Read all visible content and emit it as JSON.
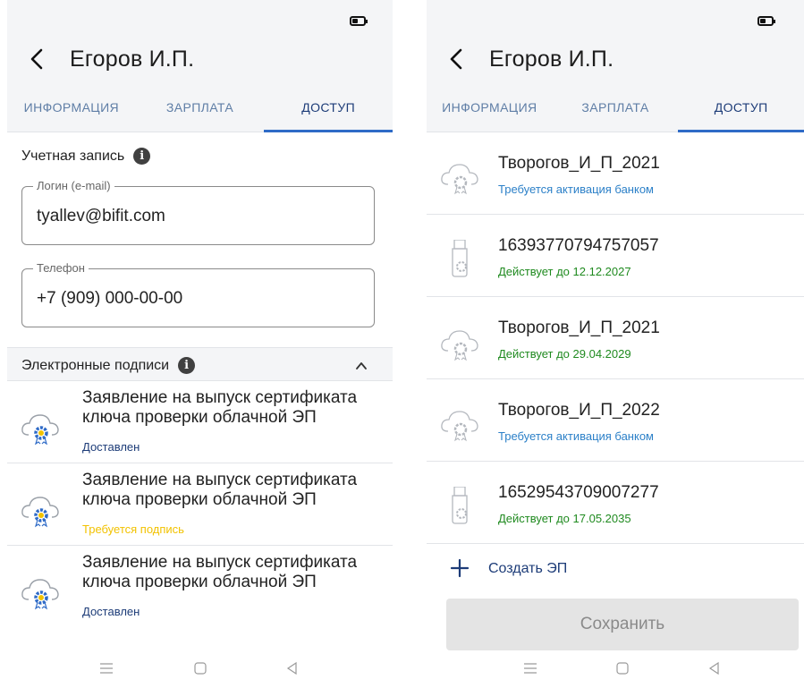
{
  "colors": {
    "accent": "#2f6bc7",
    "tab_inactive": "#5f7ea6",
    "tab_active": "#1d3c78",
    "status_blue": "#2c80c8",
    "status_green": "#1f8a1f",
    "status_yellow": "#f2c200",
    "status_navy": "#1d3c78",
    "header_bg": "#f4f5f7"
  },
  "left": {
    "header": {
      "title": "Егоров И.П.",
      "back_icon": "back-arrow-icon"
    },
    "tabs": [
      "ИНФОРМАЦИЯ",
      "ЗАРПЛАТА",
      "ДОСТУП"
    ],
    "active_tab": "ДОСТУП",
    "account": {
      "title": "Учетная запись",
      "login_label": "Логин (e-mail)",
      "login_value": "tyallev@bifit.com",
      "phone_label": "Телефон",
      "phone_value": "+7 (909) 000-00-00"
    },
    "signatures": {
      "title": "Электронные подписи",
      "items": [
        {
          "line1": "Заявление на выпуск сертификата",
          "line2": "ключа проверки облачной ЭП",
          "status": "Доставлен",
          "status_color": "navy"
        },
        {
          "line1": "Заявление на выпуск сертификата",
          "line2": "ключа проверки облачной ЭП",
          "status": "Требуется подпись",
          "status_color": "yellow"
        },
        {
          "line1": "Заявление на выпуск сертификата",
          "line2": "ключа проверки облачной ЭП",
          "status": "Доставлен",
          "status_color": "navy"
        }
      ]
    }
  },
  "right": {
    "header": {
      "title": "Егоров И.П.",
      "back_icon": "back-arrow-icon"
    },
    "tabs": [
      "ИНФОРМАЦИЯ",
      "ЗАРПЛАТА",
      "ДОСТУП"
    ],
    "active_tab": "ДОСТУП",
    "certificates": [
      {
        "name": "Творогов_И_П_2021",
        "status": "Требуется активация банком",
        "status_color": "blue",
        "icon": "cloud-cert-icon"
      },
      {
        "name": "16393770794757057",
        "status": "Действует до 12.12.2027",
        "status_color": "green",
        "icon": "usb-token-icon"
      },
      {
        "name": "Творогов_И_П_2021",
        "status": "Действует до 29.04.2029",
        "status_color": "green",
        "icon": "cloud-cert-icon"
      },
      {
        "name": "Творогов_И_П_2022",
        "status": "Требуется активация банком",
        "status_color": "blue",
        "icon": "cloud-cert-icon"
      },
      {
        "name": "16529543709007277",
        "status": "Действует до 17.05.2035",
        "status_color": "green",
        "icon": "usb-token-icon"
      }
    ],
    "create_label": "Создать ЭП",
    "save_label": "Сохранить"
  }
}
